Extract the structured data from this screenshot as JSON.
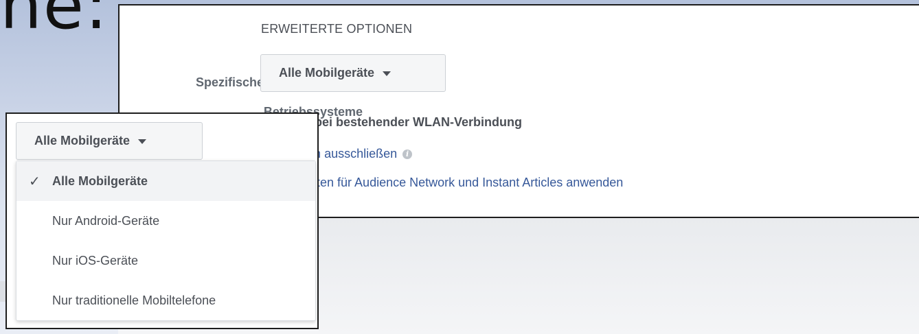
{
  "slide": {
    "title_fragment": "he:"
  },
  "advanced_options": {
    "heading": "ERWEITERTE OPTIONEN",
    "field_label_line1": "Spezifische Mobilgeräte und",
    "field_label_line2": "Betriebssysteme",
    "dropdown_value": "Alle Mobilgeräte",
    "wifi_checkbox": {
      "label": "Nur bei bestehender WLAN-Verbindung",
      "checked": true
    },
    "links": {
      "exclude_categories": "Kategorien ausschließen",
      "blocklists": "Blockierlisten für Audience Network und Instant Articles anwenden"
    }
  },
  "device_menu": {
    "dropdown_value": "Alle Mobilgeräte",
    "options": [
      {
        "label": "Alle Mobilgeräte",
        "selected": true
      },
      {
        "label": "Nur Android-Geräte",
        "selected": false
      },
      {
        "label": "Nur iOS-Geräte",
        "selected": false
      },
      {
        "label": "Nur traditionelle Mobiltelefone",
        "selected": false
      }
    ]
  },
  "icons": {
    "caret": "caret-down-icon",
    "check": "checkmark-icon",
    "info": "info-icon"
  },
  "colors": {
    "link": "#365899",
    "text": "#4b4f56",
    "label": "#606770"
  }
}
